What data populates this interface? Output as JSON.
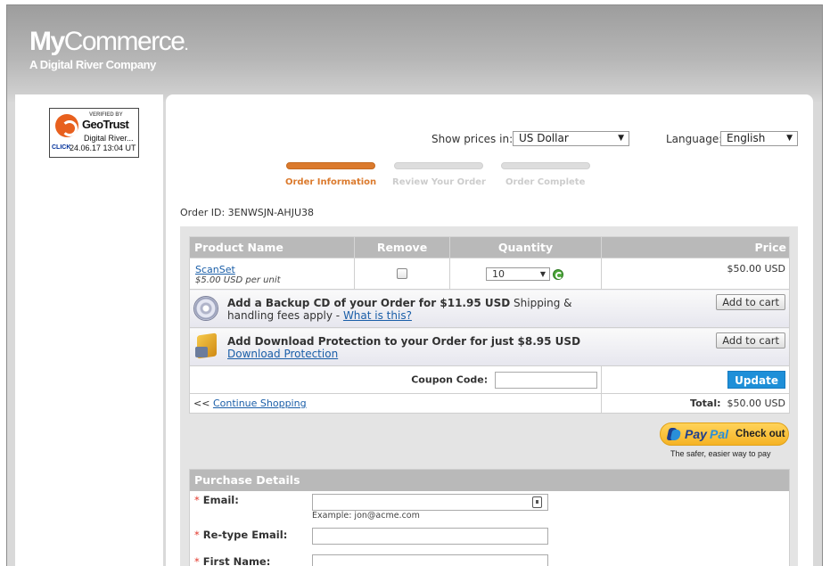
{
  "header": {
    "logo_my": "My",
    "logo_commerce": "Commerce",
    "logo_dot": ".",
    "tagline": "A Digital River Company"
  },
  "geotrust": {
    "verified": "VERIFIED BY",
    "brand": "GeoTrust",
    "name": "Digital River...",
    "click": "CLICK",
    "date": "24.06.17 13:04 UT"
  },
  "controls": {
    "prices_label": "Show prices in:",
    "currency": "US Dollar",
    "language_label": "Language:",
    "language": "English"
  },
  "steps": [
    {
      "label": "Order Information",
      "active": true
    },
    {
      "label": "Review Your Order",
      "active": false
    },
    {
      "label": "Order Complete",
      "active": false
    }
  ],
  "order": {
    "id_label": "Order ID: 3ENWSJN-AHJU38"
  },
  "cart": {
    "columns": {
      "name": "Product Name",
      "remove": "Remove",
      "quantity": "Quantity",
      "price": "Price"
    },
    "product": {
      "name": "ScanSet",
      "unit_price": "$5.00 USD per unit",
      "quantity": "10",
      "price": "$50.00 USD"
    },
    "upsells": [
      {
        "bold": "Add a Backup CD of your Order for $11.95 USD",
        "normal": " Shipping & handling fees apply - ",
        "link": "What is this?",
        "button": "Add to cart"
      },
      {
        "bold": "Add Download Protection to your Order for just $8.95 USD",
        "link": "Download Protection",
        "button": "Add to cart"
      }
    ],
    "coupon_label": "Coupon Code:",
    "update_button": "Update",
    "continue_prefix": "<< ",
    "continue_link": "Continue Shopping",
    "total_label": "Total:",
    "total_value": "$50.00 USD"
  },
  "paypal": {
    "pay": "Pay",
    "pal": "Pal",
    "checkout": "Check out",
    "tagline": "The safer, easier way to pay"
  },
  "purchase": {
    "title": "Purchase Details",
    "email_label": "Email:",
    "email_example": "Example: jon@acme.com",
    "retype_label": "Re-type Email:",
    "first_name_label": "First Name:",
    "required_mark": "*"
  }
}
